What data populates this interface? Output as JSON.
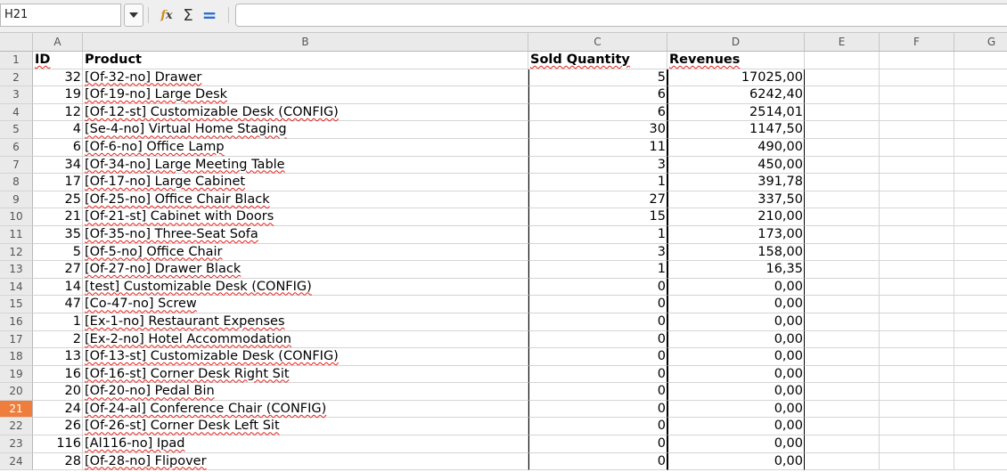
{
  "namebox": {
    "value": "H21"
  },
  "toolbar": {
    "fx_label": "fx",
    "sum_glyph": "Σ",
    "equals_glyph": "="
  },
  "formula": {
    "value": ""
  },
  "columns": [
    "A",
    "B",
    "C",
    "D",
    "E",
    "F",
    "G"
  ],
  "headers": {
    "id": "ID",
    "product": "Product",
    "sold_quantity": "Sold Quantity",
    "revenues": "Revenues"
  },
  "selected_row": 21,
  "rows": [
    {
      "num": "1"
    },
    {
      "num": "2",
      "id": "32",
      "product": "[Of-32-no] Drawer",
      "qty": "5",
      "rev": "17025,00"
    },
    {
      "num": "3",
      "id": "19",
      "product": "[Of-19-no] Large Desk",
      "qty": "6",
      "rev": "6242,40"
    },
    {
      "num": "4",
      "id": "12",
      "product": "[Of-12-st] Customizable Desk (CONFIG)",
      "qty": "6",
      "rev": "2514,01"
    },
    {
      "num": "5",
      "id": "4",
      "product": "[Se-4-no] Virtual Home Staging",
      "qty": "30",
      "rev": "1147,50"
    },
    {
      "num": "6",
      "id": "6",
      "product": "[Of-6-no] Office Lamp",
      "qty": "11",
      "rev": "490,00"
    },
    {
      "num": "7",
      "id": "34",
      "product": "[Of-34-no] Large Meeting Table",
      "qty": "3",
      "rev": "450,00"
    },
    {
      "num": "8",
      "id": "17",
      "product": "[Of-17-no] Large Cabinet",
      "qty": "1",
      "rev": "391,78"
    },
    {
      "num": "9",
      "id": "25",
      "product": "[Of-25-no] Office Chair Black",
      "qty": "27",
      "rev": "337,50"
    },
    {
      "num": "10",
      "id": "21",
      "product": "[Of-21-st] Cabinet with Doors",
      "qty": "15",
      "rev": "210,00"
    },
    {
      "num": "11",
      "id": "35",
      "product": "[Of-35-no] Three-Seat Sofa",
      "qty": "1",
      "rev": "173,00"
    },
    {
      "num": "12",
      "id": "5",
      "product": "[Of-5-no] Office Chair",
      "qty": "3",
      "rev": "158,00"
    },
    {
      "num": "13",
      "id": "27",
      "product": "[Of-27-no] Drawer Black",
      "qty": "1",
      "rev": "16,35"
    },
    {
      "num": "14",
      "id": "14",
      "product": "[test] Customizable Desk (CONFIG)",
      "qty": "0",
      "rev": "0,00"
    },
    {
      "num": "15",
      "id": "47",
      "product": "[Co-47-no] Screw",
      "qty": "0",
      "rev": "0,00"
    },
    {
      "num": "16",
      "id": "1",
      "product": "[Ex-1-no] Restaurant Expenses",
      "qty": "0",
      "rev": "0,00"
    },
    {
      "num": "17",
      "id": "2",
      "product": "[Ex-2-no] Hotel Accommodation",
      "qty": "0",
      "rev": "0,00"
    },
    {
      "num": "18",
      "id": "13",
      "product": "[Of-13-st] Customizable Desk (CONFIG)",
      "qty": "0",
      "rev": "0,00"
    },
    {
      "num": "19",
      "id": "16",
      "product": "[Of-16-st] Corner Desk Right Sit",
      "qty": "0",
      "rev": "0,00"
    },
    {
      "num": "20",
      "id": "20",
      "product": "[Of-20-no] Pedal Bin",
      "qty": "0",
      "rev": "0,00"
    },
    {
      "num": "21",
      "id": "24",
      "product": "[Of-24-al] Conference Chair (CONFIG)",
      "qty": "0",
      "rev": "0,00"
    },
    {
      "num": "22",
      "id": "26",
      "product": "[Of-26-st] Corner Desk Left Sit",
      "qty": "0",
      "rev": "0,00"
    },
    {
      "num": "23",
      "id": "116",
      "product": "[Al116-no] Ipad",
      "qty": "0",
      "rev": "0,00"
    },
    {
      "num": "24",
      "id": "28",
      "product": "[Of-28-no] Flipover",
      "qty": "0",
      "rev": "0,00"
    }
  ],
  "colors": {
    "selected_row_header": "#ef7d3c",
    "spellcheck_underline": "#e0201b",
    "equals_icon": "#2a6fd6"
  }
}
